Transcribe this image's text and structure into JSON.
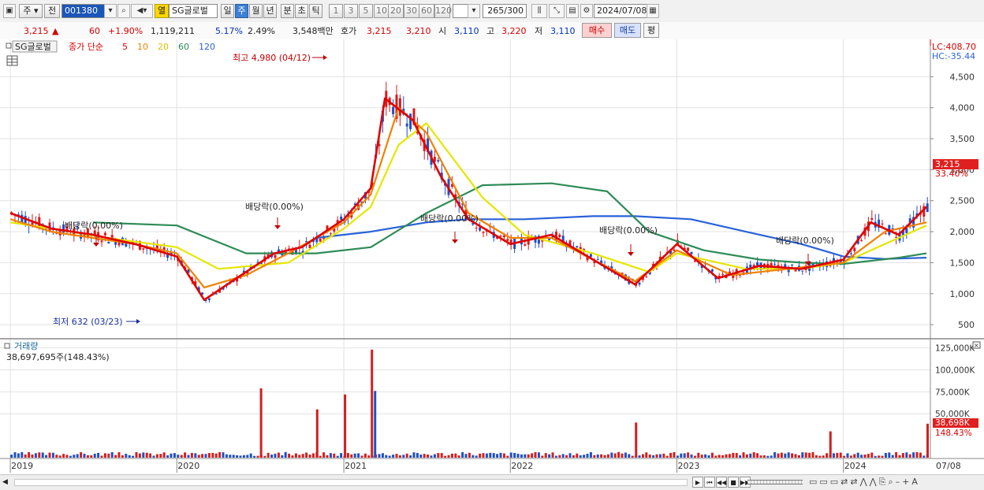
{
  "toolbar": {
    "market": "주",
    "prev": "전",
    "code": "001380",
    "stock_name": "SG글로벌",
    "open_label": "열",
    "periods": [
      "일",
      "주",
      "월",
      "년",
      "분",
      "초",
      "틱"
    ],
    "selected_period": "주",
    "intervals": [
      "1",
      "3",
      "5",
      "10",
      "20",
      "30",
      "60",
      "120"
    ],
    "count": "265",
    "count_total": "/300",
    "date": "2024/07/08"
  },
  "quote": {
    "price": "3,215",
    "arrow": "▲",
    "change": "60",
    "change_pct": "+1.90%",
    "volume": "1,119,211",
    "turnover_rate": "5.17%",
    "ratio": "2.49%",
    "amount": "3,548백만",
    "ask_label": "호가",
    "ask": "3,215",
    "bid": "3,210",
    "open_label": "시",
    "open": "3,110",
    "high_label": "고",
    "high": "3,220",
    "low_label": "저",
    "low": "3,110",
    "buy_label": "매수",
    "sell_label": "매도",
    "eval_label": "평"
  },
  "legend": {
    "stock": "SG글로벌",
    "ma_title": "종가 단순",
    "ma": [
      {
        "label": "5",
        "color": "#e00000"
      },
      {
        "label": "10",
        "color": "#f08000"
      },
      {
        "label": "20",
        "color": "#e6e600"
      },
      {
        "label": "60",
        "color": "#2e8b57"
      },
      {
        "label": "120",
        "color": "#2a62d8"
      }
    ]
  },
  "chart_data": {
    "type": "candlestick",
    "ylim": [
      400,
      5000
    ],
    "y_ticks": [
      "4,500",
      "4,000",
      "3,500",
      "3,000",
      "2,500",
      "2,000",
      "1,500",
      "1,000",
      "500"
    ],
    "x_ticks": [
      "2019",
      "2020",
      "2021",
      "2022",
      "2023",
      "2024",
      "07/08"
    ],
    "lc": "LC:408.70",
    "hc": "HC:-35.44",
    "last_price_label": "3,215",
    "last_pct_label": "33.40%",
    "high_note": "최고 4,980 (04/12)",
    "low_note": "최저 632 (03/23)",
    "dividend_notes": [
      "배당락(0.00%)",
      "배당락(0.00%)",
      "배당락(0.00%)",
      "배당락(0.00%)",
      "배당락(0.00%)"
    ],
    "series": [
      {
        "name": "5",
        "color": "#e00000",
        "dates": [
          "2019-01",
          "2019-04",
          "2019-07",
          "2019-10",
          "2020-01",
          "2020-03",
          "2020-05",
          "2020-08",
          "2020-10",
          "2021-01",
          "2021-03",
          "2021-04",
          "2021-06",
          "2021-08",
          "2021-10",
          "2022-01",
          "2022-04",
          "2022-07",
          "2022-10",
          "2023-01",
          "2023-04",
          "2023-07",
          "2023-10",
          "2024-01",
          "2024-03",
          "2024-05",
          "2024-07"
        ],
        "values": [
          2300,
          2050,
          1950,
          1800,
          1600,
          900,
          1200,
          1650,
          1750,
          2200,
          2700,
          4150,
          3800,
          2900,
          2200,
          1800,
          1950,
          1550,
          1150,
          1800,
          1250,
          1450,
          1400,
          1550,
          2150,
          1950,
          2400
        ]
      },
      {
        "name": "10",
        "color": "#f08000",
        "dates": [
          "2019-01",
          "2019-04",
          "2019-07",
          "2019-10",
          "2020-01",
          "2020-03",
          "2020-06",
          "2020-09",
          "2021-01",
          "2021-03",
          "2021-05",
          "2021-07",
          "2021-10",
          "2022-01",
          "2022-04",
          "2022-07",
          "2022-10",
          "2023-01",
          "2023-05",
          "2023-09",
          "2024-01",
          "2024-04",
          "2024-07"
        ],
        "values": [
          2200,
          2000,
          1900,
          1800,
          1650,
          1100,
          1300,
          1650,
          2150,
          2600,
          4000,
          3600,
          2300,
          1900,
          1900,
          1550,
          1200,
          1700,
          1300,
          1400,
          1500,
          2000,
          2150
        ]
      },
      {
        "name": "20",
        "color": "#e6e600",
        "dates": [
          "2019-01",
          "2019-04",
          "2019-08",
          "2020-01",
          "2020-04",
          "2020-09",
          "2021-01",
          "2021-03",
          "2021-05",
          "2021-07",
          "2021-11",
          "2022-02",
          "2022-07",
          "2022-11",
          "2023-01",
          "2023-06",
          "2023-10",
          "2024-01",
          "2024-04",
          "2024-07"
        ],
        "values": [
          2150,
          2050,
          1900,
          1750,
          1400,
          1500,
          2050,
          2400,
          3400,
          3750,
          2550,
          1950,
          1650,
          1350,
          1650,
          1400,
          1400,
          1500,
          1800,
          2100
        ]
      },
      {
        "name": "60",
        "color": "#2e8b57",
        "dates": [
          "2019-07",
          "2020-01",
          "2020-06",
          "2020-11",
          "2021-03",
          "2021-07",
          "2021-11",
          "2022-04",
          "2022-08",
          "2022-11",
          "2023-03",
          "2023-07",
          "2023-10",
          "2024-01",
          "2024-05",
          "2024-07"
        ],
        "values": [
          2150,
          2100,
          1650,
          1650,
          1750,
          2300,
          2750,
          2780,
          2650,
          2000,
          1700,
          1550,
          1500,
          1480,
          1580,
          1650
        ]
      },
      {
        "name": "120",
        "color": "#2a62d8",
        "dates": [
          "2020-11",
          "2021-03",
          "2021-07",
          "2021-10",
          "2022-02",
          "2022-07",
          "2022-10",
          "2023-02",
          "2023-06",
          "2023-10",
          "2024-01",
          "2024-04",
          "2024-07"
        ],
        "values": [
          1900,
          2000,
          2150,
          2200,
          2200,
          2250,
          2250,
          2200,
          2000,
          1800,
          1600,
          1560,
          1580
        ]
      }
    ],
    "volume": {
      "label": "거래량",
      "value_label": "38,697,695주(148.43%)",
      "ylim": [
        0,
        130000
      ],
      "y_ticks": [
        "125,000K",
        "100,000K",
        "75,000K",
        "50,000K"
      ],
      "last_label": "38,698K",
      "last_pct_label": "148.43%",
      "peaks": [
        {
          "date": "2020-07",
          "value": 79000,
          "color": "#d02020"
        },
        {
          "date": "2020-11",
          "value": 55000,
          "color": "#d02020"
        },
        {
          "date": "2021-01",
          "value": 72000,
          "color": "#d02020"
        },
        {
          "date": "2021-03",
          "value": 123000,
          "color": "#d02020"
        },
        {
          "date": "2021-03",
          "value": 76000,
          "color": "#2050c0"
        },
        {
          "date": "2022-10",
          "value": 40000,
          "color": "#d02020"
        },
        {
          "date": "2023-12",
          "value": 30000,
          "color": "#d02020"
        },
        {
          "date": "2024-07",
          "value": 38698,
          "color": "#d02020"
        }
      ]
    }
  },
  "bottom": {
    "nav": [
      "▶",
      "⏮",
      "◀◀",
      "■",
      "▶▶"
    ]
  }
}
